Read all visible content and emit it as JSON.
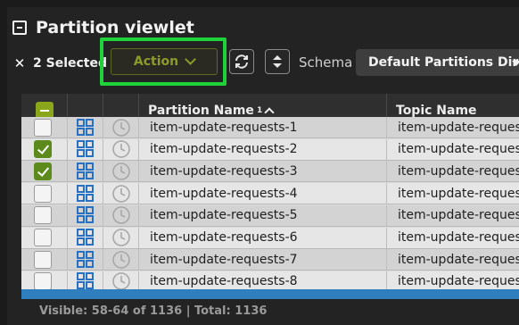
{
  "panel": {
    "title": "Partition viewlet"
  },
  "toolbar": {
    "selected_label": "2 Selected",
    "action_label": "Action",
    "schema_label": "Schema",
    "schema_value": "Default Partitions Dir"
  },
  "grid": {
    "columns": {
      "partition": "Partition Name",
      "partition_sort": "1",
      "topic": "Topic Name"
    },
    "rows": [
      {
        "name": "item-update-requests-1",
        "topic": "item-update-requests",
        "checked": false
      },
      {
        "name": "item-update-requests-2",
        "topic": "item-update-requests",
        "checked": true
      },
      {
        "name": "item-update-requests-3",
        "topic": "item-update-requests",
        "checked": true
      },
      {
        "name": "item-update-requests-4",
        "topic": "item-update-requests",
        "checked": false
      },
      {
        "name": "item-update-requests-5",
        "topic": "item-update-requests",
        "checked": false
      },
      {
        "name": "item-update-requests-6",
        "topic": "item-update-requests",
        "checked": false
      },
      {
        "name": "item-update-requests-7",
        "topic": "item-update-requests",
        "checked": false
      },
      {
        "name": "item-update-requests-8",
        "topic": "item-update-requests",
        "checked": false
      }
    ]
  },
  "footer": {
    "status": "Visible: 58-64 of 1136 | Total: 1136"
  },
  "colors": {
    "accent_green": "#8aa61a",
    "highlight": "#1fd23a",
    "scroll_blue": "#2f7fbf"
  }
}
